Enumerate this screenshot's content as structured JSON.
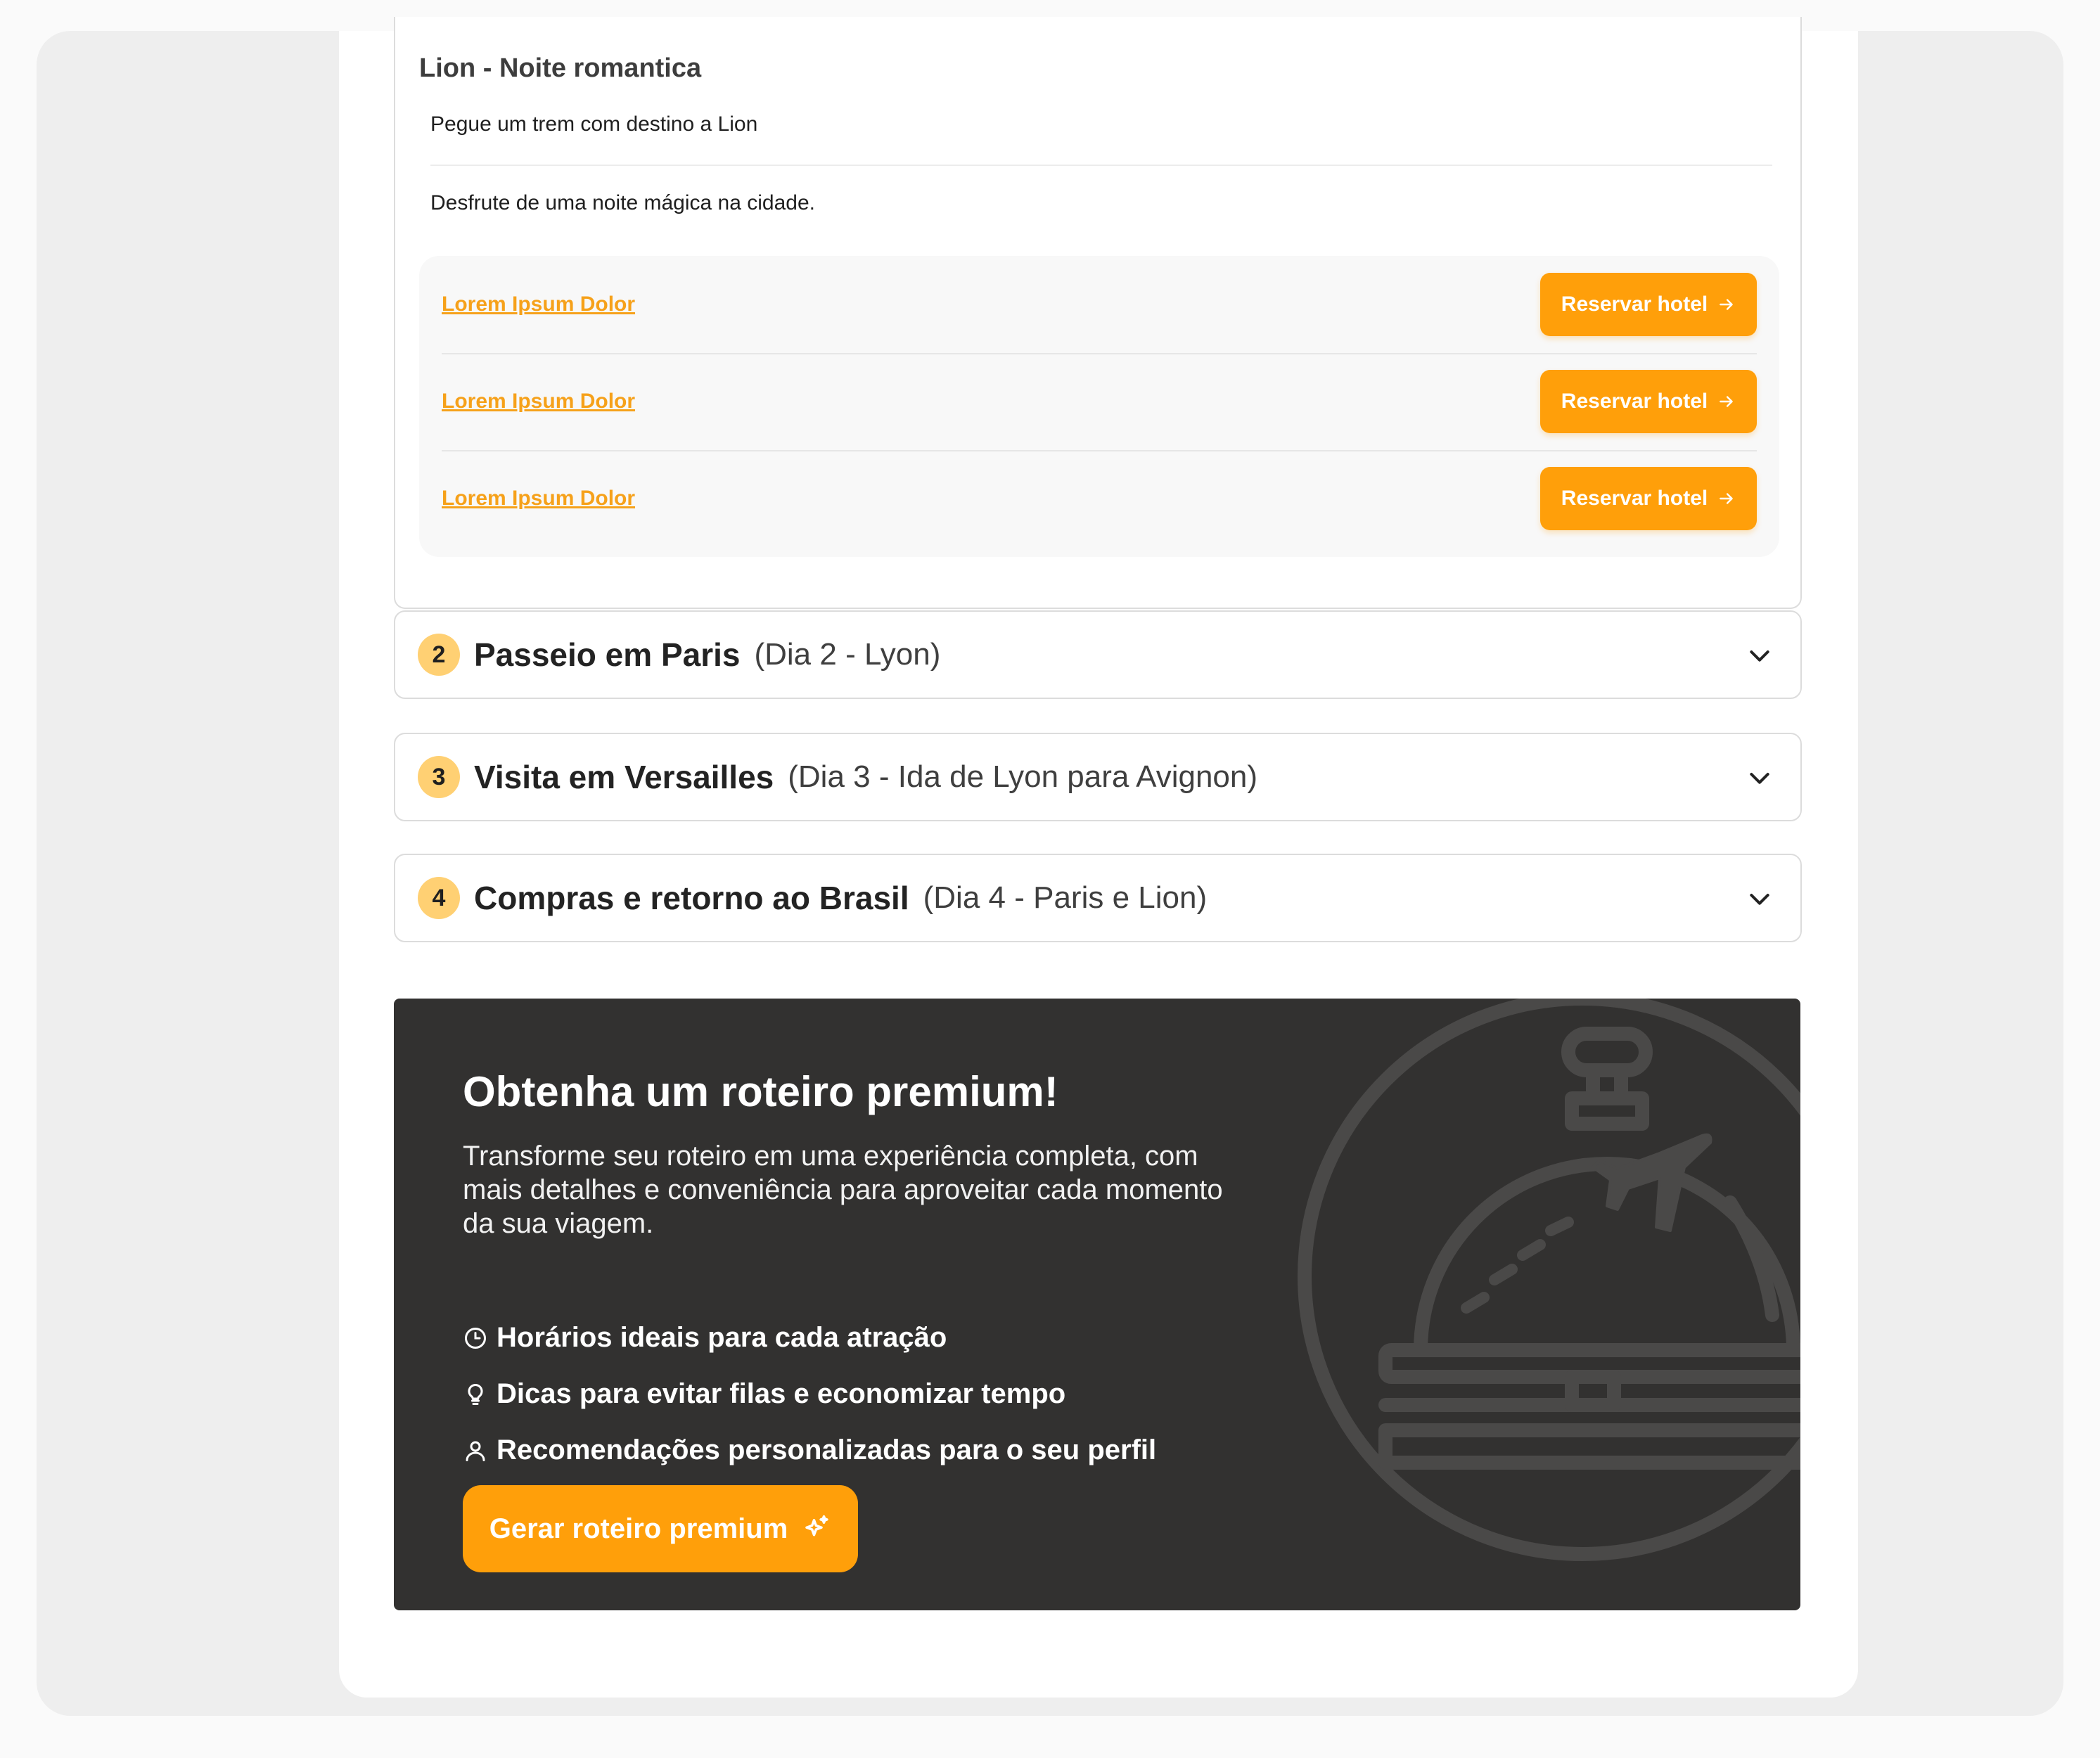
{
  "day1": {
    "title": "Lion - Noite romantica",
    "activities": [
      "Pegue um trem com destino a Lion",
      "Desfrute de uma noite mágica na cidade."
    ],
    "hotels": [
      {
        "name": "Lorem Ipsum Dolor",
        "button": "Reservar hotel"
      },
      {
        "name": "Lorem Ipsum Dolor",
        "button": "Reservar hotel"
      },
      {
        "name": "Lorem Ipsum Dolor",
        "button": "Reservar hotel"
      }
    ]
  },
  "days": [
    {
      "number": "2",
      "title": "Passeio em Paris",
      "subtitle": "(Dia 2 - Lyon)"
    },
    {
      "number": "3",
      "title": "Visita em Versailles",
      "subtitle": "(Dia 3 - Ida de Lyon para Avignon)"
    },
    {
      "number": "4",
      "title": "Compras e retorno ao Brasil",
      "subtitle": "(Dia 4 - Paris e Lion)"
    }
  ],
  "premium": {
    "title": "Obtenha um roteiro premium!",
    "description": "Transforme seu roteiro em uma experiência completa, com mais detalhes e conveniência para aproveitar cada momento da sua viagem.",
    "benefits": [
      {
        "icon": "clock-icon",
        "text": "Horários ideais para cada atração"
      },
      {
        "icon": "lightbulb-icon",
        "text": "Dicas para evitar filas e economizar tempo"
      },
      {
        "icon": "user-icon",
        "text": "Recomendações personalizadas para o seu perfil"
      }
    ],
    "button": "Gerar roteiro premium"
  },
  "colors": {
    "accent": "#ff9f0a",
    "badge": "#ffd073",
    "premium_bg": "#323130",
    "link": "#f6a11a"
  }
}
